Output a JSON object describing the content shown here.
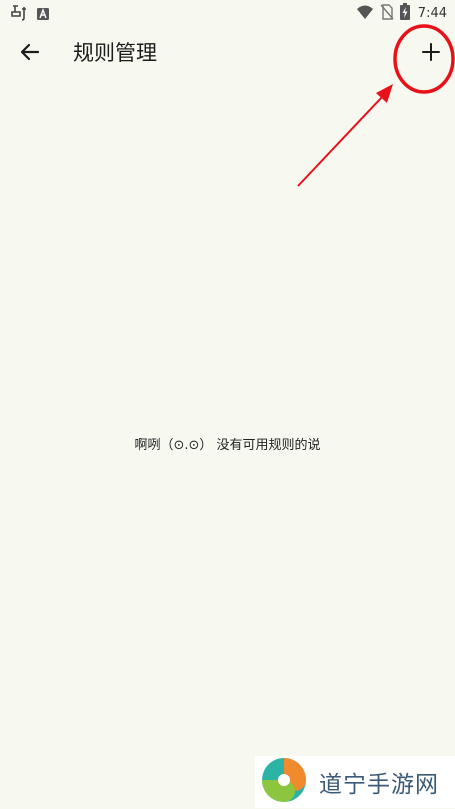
{
  "status_bar": {
    "time": "7:44",
    "left_icons": [
      "notification-app-icon",
      "text-a-icon"
    ],
    "right_icons": [
      "wifi-icon",
      "no-sim-icon",
      "battery-charging-icon"
    ]
  },
  "app_bar": {
    "back_icon": "arrow-left-icon",
    "title": "规则管理",
    "add_icon": "plus-icon"
  },
  "main": {
    "empty_message": "啊咧（⊙.⊙） 没有可用规则的说"
  },
  "annotation": {
    "color": "#e8111a",
    "shapes": [
      "circle",
      "arrow"
    ]
  },
  "watermark": {
    "text": "道宁手游网"
  },
  "colors": {
    "background": "#f7f9f1",
    "text": "#1c1c1c"
  }
}
